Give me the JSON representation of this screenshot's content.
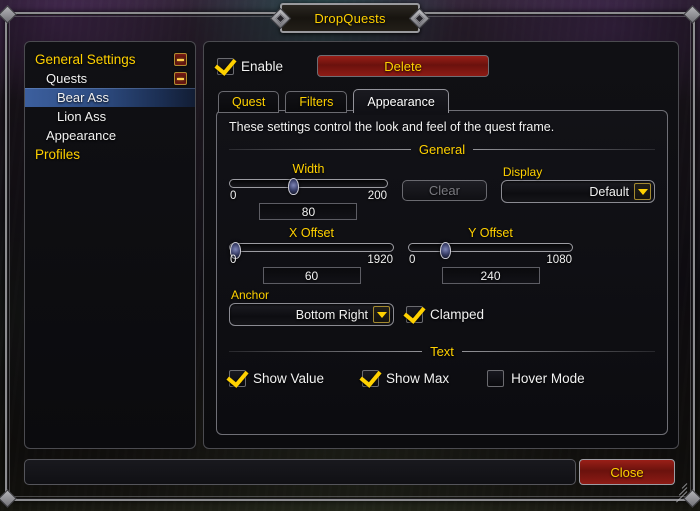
{
  "window": {
    "title": "DropQuests"
  },
  "sidebar": {
    "items": [
      {
        "label": "General Settings",
        "level": 0,
        "selected": false,
        "toggle": true
      },
      {
        "label": "Quests",
        "level": 1,
        "selected": false,
        "toggle": true
      },
      {
        "label": "Bear Ass",
        "level": 2,
        "selected": true,
        "toggle": false
      },
      {
        "label": "Lion Ass",
        "level": 2,
        "selected": false,
        "toggle": false
      },
      {
        "label": "Appearance",
        "level": 1,
        "selected": false,
        "toggle": false
      },
      {
        "label": "Profiles",
        "level": 0,
        "selected": false,
        "toggle": false
      }
    ]
  },
  "content": {
    "enable": {
      "label": "Enable",
      "checked": true
    },
    "delete_button": "Delete",
    "tabs": [
      {
        "label": "Quest",
        "active": false
      },
      {
        "label": "Filters",
        "active": false
      },
      {
        "label": "Appearance",
        "active": true
      }
    ],
    "description": "These settings control the look and feel of the quest frame.",
    "sections": {
      "general": "General",
      "text": "Text"
    },
    "width_slider": {
      "title": "Width",
      "min": "0",
      "max": "200",
      "value": "80",
      "percent": 40
    },
    "clear_button": "Clear",
    "display_dropdown": {
      "label": "Display",
      "value": "Default"
    },
    "x_offset_slider": {
      "title": "X Offset",
      "min": "0",
      "max": "1920",
      "value": "60",
      "percent": 3
    },
    "y_offset_slider": {
      "title": "Y Offset",
      "min": "0",
      "max": "1080",
      "value": "240",
      "percent": 22
    },
    "anchor_dropdown": {
      "label": "Anchor",
      "value": "Bottom Right"
    },
    "clamped": {
      "label": "Clamped",
      "checked": true
    },
    "show_value": {
      "label": "Show Value",
      "checked": true
    },
    "show_max": {
      "label": "Show Max",
      "checked": true
    },
    "hover_mode": {
      "label": "Hover Mode",
      "checked": false
    }
  },
  "footer": {
    "status_text": "",
    "close_button": "Close"
  },
  "colors": {
    "gold": "#ffd100",
    "red": "#8e1b15",
    "selection_blue": "#3c5f9e",
    "text_white": "#f2f2f2"
  }
}
